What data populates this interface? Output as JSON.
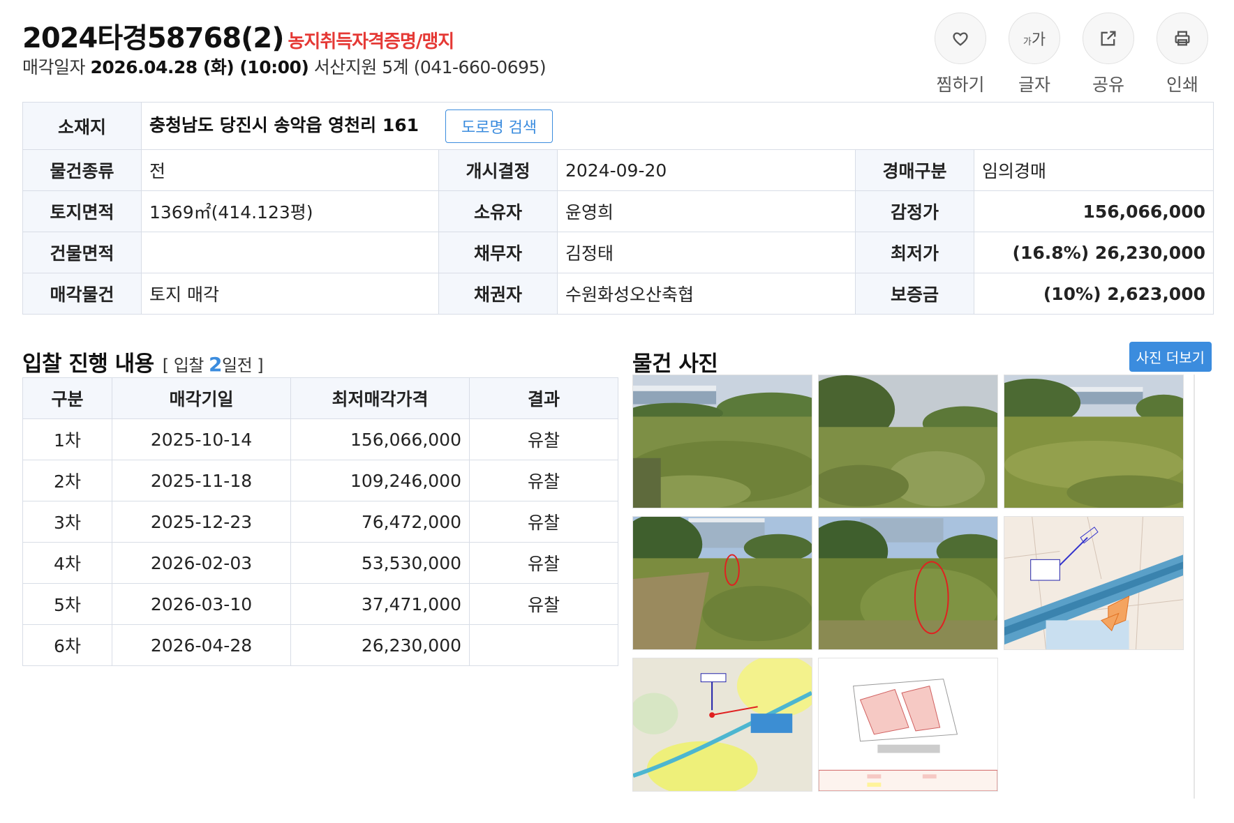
{
  "header": {
    "case_number": "2024타경58768(2)",
    "tag": "농지취득자격증명/맹지",
    "sale_label": "매각일자",
    "sale_datetime": "2026.04.28 (화) (10:00)",
    "court": "서산지원 5계 (041-660-0695)"
  },
  "actions": {
    "favorite": "찜하기",
    "font_glyph": "가",
    "font": "글자",
    "share": "공유",
    "print": "인쇄"
  },
  "info": {
    "address_label": "소재지",
    "address": "충청남도 당진시 송악읍 영천리 161",
    "road_search": "도로명 검색",
    "type_label": "물건종류",
    "type": "전",
    "start_label": "개시결정",
    "start": "2024-09-20",
    "auction_kind_label": "경매구분",
    "auction_kind": "임의경매",
    "land_area_label": "토지면적",
    "land_area": "1369㎡(414.123평)",
    "owner_label": "소유자",
    "owner": "윤영희",
    "appraisal_label": "감정가",
    "appraisal": "156,066,000",
    "building_area_label": "건물면적",
    "building_area": "",
    "debtor_label": "채무자",
    "debtor": "김정태",
    "min_price_label": "최저가",
    "min_price": "(16.8%) 26,230,000",
    "sale_item_label": "매각물건",
    "sale_item": "토지 매각",
    "creditor_label": "채권자",
    "creditor": "수원화성오산축협",
    "deposit_label": "보증금",
    "deposit": "(10%) 2,623,000"
  },
  "bids": {
    "title": "입찰 진행 내용",
    "sub_prefix": "[ 입찰 ",
    "days": "2",
    "sub_suffix": "일전 ]",
    "columns": [
      "구분",
      "매각기일",
      "최저매각가격",
      "결과"
    ],
    "rows": [
      [
        "1차",
        "2025-10-14",
        "156,066,000",
        "유찰"
      ],
      [
        "2차",
        "2025-11-18",
        "109,246,000",
        "유찰"
      ],
      [
        "3차",
        "2025-12-23",
        "76,472,000",
        "유찰"
      ],
      [
        "4차",
        "2026-02-03",
        "53,530,000",
        "유찰"
      ],
      [
        "5차",
        "2026-03-10",
        "37,471,000",
        "유찰"
      ],
      [
        "6차",
        "2026-04-28",
        "26,230,000",
        ""
      ]
    ]
  },
  "photos": {
    "title": "물건 사진",
    "more": "사진 더보기",
    "items": [
      {
        "kind": "field-photo"
      },
      {
        "kind": "field-photo"
      },
      {
        "kind": "field-photo"
      },
      {
        "kind": "field-photo-marked"
      },
      {
        "kind": "field-photo-marked"
      },
      {
        "kind": "cadastral-map"
      },
      {
        "kind": "location-map"
      },
      {
        "kind": "site-plan"
      }
    ]
  },
  "colors": {
    "accent": "#3b8cde",
    "tag_red": "#e53935",
    "header_cell": "#f4f7fc"
  }
}
